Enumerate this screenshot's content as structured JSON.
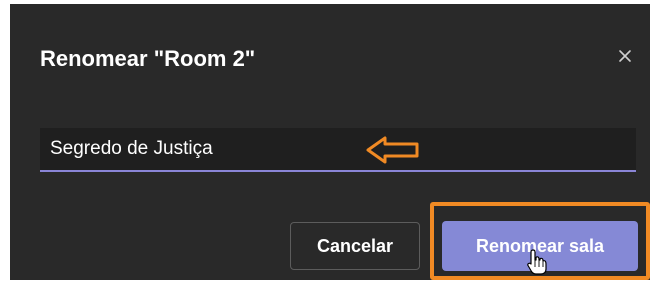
{
  "dialog": {
    "title": "Renomear \"Room 2\"",
    "close_icon": "close-icon",
    "input": {
      "value": "Segredo de Justiça"
    },
    "buttons": {
      "cancel_label": "Cancelar",
      "confirm_label": "Renomear sala"
    }
  },
  "annotations": {
    "arrow_icon": "left-arrow-outline",
    "highlight_color": "#f08a24"
  },
  "colors": {
    "dialog_bg": "#292929",
    "input_underline": "#8a85d6",
    "primary_button": "#8589d6"
  }
}
